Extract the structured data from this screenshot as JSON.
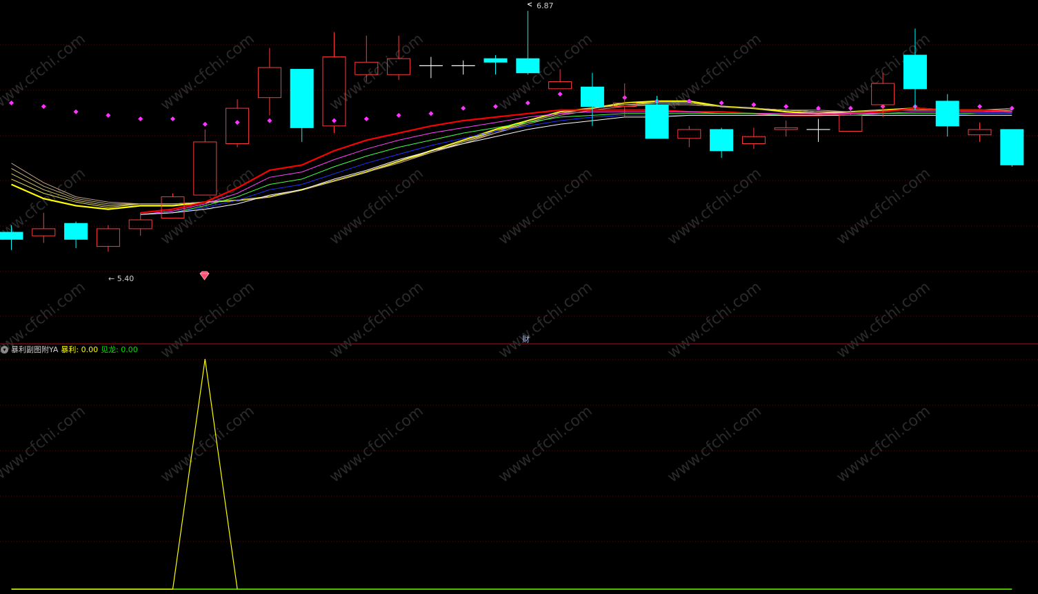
{
  "colors": {
    "bg": "#000000",
    "up": "#ff3b3b",
    "down": "#00ffff",
    "flat": "#ffffff",
    "grid": "#5a0d0d",
    "divider": "#b01010",
    "dot": "#ff33ff",
    "ribbon": [
      "#ffff00",
      "#e8e050",
      "#d6c86a",
      "#c9b27a",
      "#bfa38a",
      "#ff0000",
      "#ff44ff",
      "#44ff44",
      "#2233ff",
      "#ffffff"
    ],
    "indicator_line": "#ffff00",
    "baseline": "#66ff00"
  },
  "annotations": {
    "high_label": "6.87",
    "low_label": "5.40",
    "cai_label": "财"
  },
  "indicator": {
    "name": "暴利副图附YA",
    "v1_label": "暴利: 0.00",
    "v2_label": "见龙: 0.00"
  },
  "watermark": "www.cfchi.com",
  "chart_data": [
    {
      "type": "candlestick",
      "ylim": [
        5.2,
        6.9
      ],
      "candles": [
        {
          "o": 5.62,
          "c": 5.58,
          "h": 5.66,
          "l": 5.52
        },
        {
          "o": 5.6,
          "c": 5.64,
          "h": 5.73,
          "l": 5.56
        },
        {
          "o": 5.67,
          "c": 5.58,
          "h": 5.68,
          "l": 5.53
        },
        {
          "o": 5.54,
          "c": 5.64,
          "h": 5.66,
          "l": 5.51
        },
        {
          "o": 5.64,
          "c": 5.69,
          "h": 5.73,
          "l": 5.6
        },
        {
          "o": 5.7,
          "c": 5.82,
          "h": 5.84,
          "l": 5.7
        },
        {
          "o": 5.83,
          "c": 6.13,
          "h": 6.2,
          "l": 5.83
        },
        {
          "o": 6.12,
          "c": 6.32,
          "h": 6.37,
          "l": 6.1
        },
        {
          "o": 6.38,
          "c": 6.55,
          "h": 6.66,
          "l": 6.28
        },
        {
          "o": 6.54,
          "c": 6.21,
          "h": 6.54,
          "l": 6.13
        },
        {
          "o": 6.22,
          "c": 6.61,
          "h": 6.75,
          "l": 6.18
        },
        {
          "o": 6.51,
          "c": 6.58,
          "h": 6.73,
          "l": 6.47
        },
        {
          "o": 6.51,
          "c": 6.6,
          "h": 6.73,
          "l": 6.48
        },
        {
          "o": 6.56,
          "c": 6.56,
          "h": 6.61,
          "l": 6.49
        },
        {
          "o": 6.56,
          "c": 6.56,
          "h": 6.59,
          "l": 6.51
        },
        {
          "o": 6.6,
          "c": 6.58,
          "h": 6.62,
          "l": 6.51
        },
        {
          "o": 6.6,
          "c": 6.52,
          "h": 6.87,
          "l": 6.51
        },
        {
          "o": 6.43,
          "c": 6.47,
          "h": 6.54,
          "l": 6.43
        },
        {
          "o": 6.44,
          "c": 6.33,
          "h": 6.52,
          "l": 6.22
        },
        {
          "o": 6.33,
          "c": 6.35,
          "h": 6.46,
          "l": 6.27
        },
        {
          "o": 6.34,
          "c": 6.15,
          "h": 6.39,
          "l": 6.15
        },
        {
          "o": 6.15,
          "c": 6.2,
          "h": 6.22,
          "l": 6.1
        },
        {
          "o": 6.2,
          "c": 6.08,
          "h": 6.21,
          "l": 6.04
        },
        {
          "o": 6.12,
          "c": 6.16,
          "h": 6.21,
          "l": 6.09
        },
        {
          "o": 6.2,
          "c": 6.21,
          "h": 6.25,
          "l": 6.16
        },
        {
          "o": 6.2,
          "c": 6.2,
          "h": 6.26,
          "l": 6.13
        },
        {
          "o": 6.19,
          "c": 6.28,
          "h": 6.32,
          "l": 6.19
        },
        {
          "o": 6.34,
          "c": 6.46,
          "h": 6.52,
          "l": 6.27
        },
        {
          "o": 6.62,
          "c": 6.43,
          "h": 6.77,
          "l": 6.31
        },
        {
          "o": 6.36,
          "c": 6.22,
          "h": 6.4,
          "l": 6.16
        },
        {
          "o": 6.17,
          "c": 6.2,
          "h": 6.24,
          "l": 6.13
        },
        {
          "o": 6.2,
          "c": 6.0,
          "h": 6.2,
          "l": 5.99
        }
      ],
      "dots": [
        6.35,
        6.33,
        6.3,
        6.28,
        6.26,
        6.26,
        6.23,
        6.24,
        6.25,
        6.25,
        6.25,
        6.26,
        6.28,
        6.29,
        6.32,
        6.33,
        6.35,
        6.4,
        6.37,
        6.38,
        6.36,
        6.36,
        6.35,
        6.34,
        6.33,
        6.32,
        6.32,
        6.33,
        6.33,
        6.33,
        6.33,
        6.32
      ],
      "ribbons": [
        [
          5.89,
          5.81,
          5.77,
          5.75,
          5.77,
          5.77,
          5.79,
          5.8,
          5.82,
          5.86,
          5.91,
          5.96,
          6.02,
          6.08,
          6.14,
          6.2,
          6.25,
          6.3,
          6.32,
          6.35,
          6.36,
          6.36,
          6.33,
          6.32,
          6.3,
          6.29,
          6.3,
          6.31,
          6.32,
          6.31,
          6.31,
          6.3
        ],
        [
          5.92,
          5.84,
          5.79,
          5.76,
          5.78,
          5.78,
          5.79,
          5.8,
          5.82,
          5.86,
          5.91,
          5.96,
          6.02,
          6.08,
          6.14,
          6.19,
          6.25,
          6.3,
          6.32,
          6.35,
          6.35,
          6.35,
          6.33,
          6.32,
          6.31,
          6.3,
          6.3,
          6.31,
          6.32,
          6.31,
          6.31,
          6.3
        ],
        [
          5.95,
          5.86,
          5.8,
          5.77,
          5.78,
          5.78,
          5.79,
          5.8,
          5.82,
          5.86,
          5.91,
          5.96,
          6.02,
          6.07,
          6.13,
          6.19,
          6.24,
          6.29,
          6.32,
          6.34,
          6.35,
          6.35,
          6.33,
          6.32,
          6.31,
          6.3,
          6.3,
          6.31,
          6.31,
          6.31,
          6.31,
          6.31
        ],
        [
          5.98,
          5.88,
          5.81,
          5.78,
          5.78,
          5.78,
          5.79,
          5.8,
          5.82,
          5.86,
          5.91,
          5.96,
          6.01,
          6.07,
          6.13,
          6.18,
          6.24,
          6.29,
          6.32,
          6.34,
          6.34,
          6.34,
          6.33,
          6.32,
          6.31,
          6.3,
          6.3,
          6.31,
          6.31,
          6.31,
          6.31,
          6.31
        ],
        [
          6.01,
          5.9,
          5.82,
          5.79,
          5.78,
          5.78,
          5.79,
          5.8,
          5.82,
          5.86,
          5.91,
          5.96,
          6.01,
          6.07,
          6.12,
          6.18,
          6.23,
          6.28,
          6.31,
          6.33,
          6.34,
          6.34,
          6.33,
          6.32,
          6.31,
          6.31,
          6.3,
          6.31,
          6.31,
          6.31,
          6.31,
          6.32
        ],
        [
          null,
          null,
          null,
          null,
          5.73,
          5.75,
          5.79,
          5.87,
          5.97,
          6.0,
          6.08,
          6.14,
          6.18,
          6.22,
          6.25,
          6.27,
          6.29,
          6.31,
          6.31,
          6.31,
          6.31,
          6.3,
          6.3,
          6.29,
          6.28,
          6.28,
          6.29,
          6.3,
          6.32,
          6.31,
          6.31,
          6.3
        ],
        [
          null,
          null,
          null,
          null,
          5.72,
          5.74,
          5.78,
          5.84,
          5.93,
          5.96,
          6.03,
          6.09,
          6.14,
          6.18,
          6.21,
          6.24,
          6.27,
          6.29,
          6.3,
          6.3,
          6.3,
          6.3,
          6.29,
          6.29,
          6.29,
          6.29,
          6.29,
          6.29,
          6.3,
          6.3,
          6.3,
          6.3
        ],
        [
          null,
          null,
          null,
          null,
          5.72,
          5.73,
          5.77,
          5.82,
          5.89,
          5.92,
          5.99,
          6.05,
          6.1,
          6.14,
          6.18,
          6.21,
          6.24,
          6.27,
          6.28,
          6.29,
          6.29,
          6.29,
          6.29,
          6.29,
          6.28,
          6.28,
          6.28,
          6.29,
          6.29,
          6.29,
          6.29,
          6.29
        ],
        [
          null,
          null,
          null,
          null,
          5.72,
          5.73,
          5.76,
          5.8,
          5.86,
          5.89,
          5.95,
          6.01,
          6.06,
          6.11,
          6.15,
          6.19,
          6.22,
          6.25,
          6.27,
          6.28,
          6.28,
          6.28,
          6.28,
          6.28,
          6.28,
          6.28,
          6.28,
          6.28,
          6.28,
          6.28,
          6.29,
          6.29
        ],
        [
          null,
          null,
          null,
          null,
          5.72,
          5.73,
          5.75,
          5.78,
          5.83,
          5.86,
          5.92,
          5.97,
          6.03,
          6.08,
          6.12,
          6.16,
          6.2,
          6.23,
          6.25,
          6.27,
          6.27,
          6.28,
          6.28,
          6.28,
          6.28,
          6.28,
          6.28,
          6.28,
          6.28,
          6.28,
          6.28,
          6.28
        ]
      ]
    },
    {
      "type": "line",
      "ylim": [
        0,
        1
      ],
      "series": [
        {
          "values": [
            0,
            0,
            0,
            0,
            0,
            0,
            1,
            0,
            0,
            0,
            0,
            0,
            0,
            0,
            0,
            0,
            0,
            0,
            0,
            0,
            0,
            0,
            0,
            0,
            0,
            0,
            0,
            0,
            0,
            0,
            0,
            0
          ]
        }
      ]
    }
  ]
}
